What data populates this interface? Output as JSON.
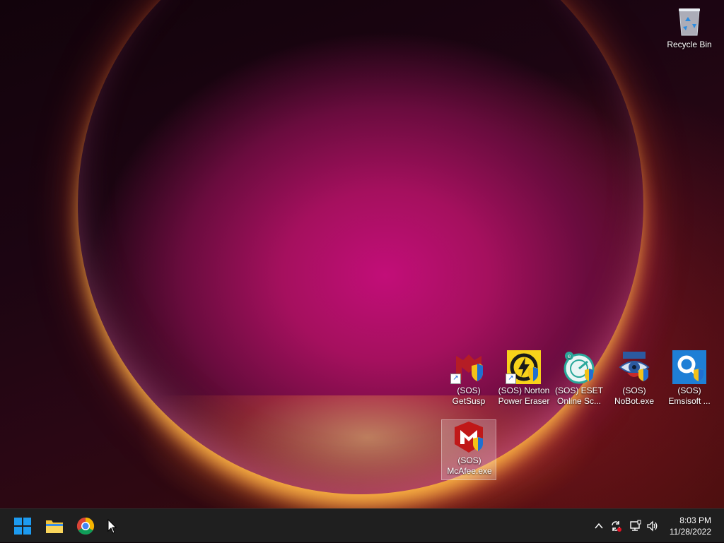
{
  "desktop": {
    "icons": [
      {
        "name": "recycle-bin",
        "label": "Recycle Bin"
      },
      {
        "name": "getsusp",
        "label": "(SOS) GetSusp"
      },
      {
        "name": "norton-power-eraser",
        "label": "(SOS) Norton Power Eraser"
      },
      {
        "name": "eset-online-scanner",
        "label": "(SOS) ESET Online Sc..."
      },
      {
        "name": "nobot",
        "label": "(SOS) NoBot.exe"
      },
      {
        "name": "emsisoft",
        "label": "(SOS) Emsisoft ..."
      },
      {
        "name": "mcafee",
        "label": "(SOS) McAfee.exe"
      }
    ]
  },
  "taskbar": {
    "start": "start-button",
    "pinned": [
      "file-explorer",
      "google-chrome"
    ],
    "tray": {
      "overflow_icon": "chevron-up-icon",
      "icons": [
        "sync-icon",
        "network-icon",
        "volume-icon"
      ]
    },
    "clock": {
      "time": "8:03 PM",
      "date": "11/28/2022"
    }
  },
  "colors": {
    "taskbar": "#1f1f1f",
    "wallpaper_core": "#c20e78",
    "wallpaper_glow": "#ffbe46",
    "windows_blue": "#0a84ff"
  }
}
